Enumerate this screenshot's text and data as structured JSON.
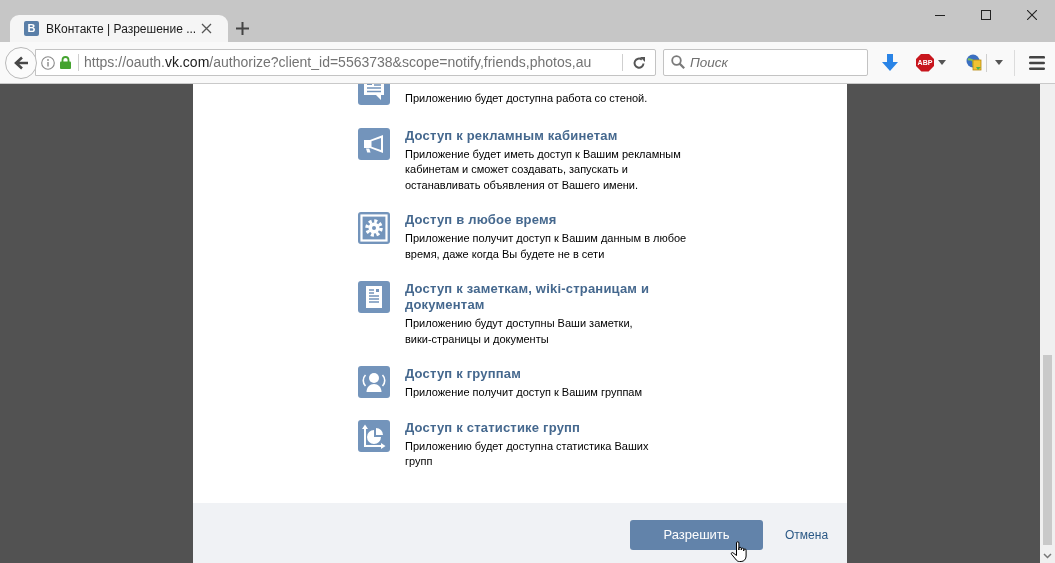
{
  "browser": {
    "tab": {
      "favicon_letter": "В",
      "title": "ВКонтакте | Разрешение ...",
      "selected": true
    },
    "address_bar": {
      "url_start": "https://oauth.",
      "url_domain": "vk.com",
      "url_rest": "/authorize?client_id=5563738&scope=notify,friends,photos,au"
    },
    "search": {
      "placeholder": "Поиск"
    },
    "adblock_label": "ABP"
  },
  "permissions": [
    {
      "kind": "wall",
      "description": "Приложению будет доступна работа со стеной."
    },
    {
      "kind": "ads",
      "title": "Доступ к рекламным кабинетам",
      "description": "Приложение будет иметь доступ к Вашим рекламным\nкабинетам и сможет создавать, запускать и\nостанавливать объявления от Вашего имени."
    },
    {
      "kind": "offline",
      "title": "Доступ в любое время",
      "description": "Приложение получит доступ к Вашим данным в любое\nвремя, даже когда Вы будете не в сети"
    },
    {
      "kind": "docs",
      "title": "Доступ к заметкам, wiki-страницам и\nдокументам",
      "description": "Приложению будут доступны Ваши заметки,\nвики-страницы и документы"
    },
    {
      "kind": "groups",
      "title": "Доступ к группам",
      "description": "Приложение получит доступ к Вашим группам"
    },
    {
      "kind": "stats",
      "title": "Доступ к статистике групп",
      "description": "Приложению будет доступна статистика Ваших\nгрупп"
    }
  ],
  "actions": {
    "allow_button": "Разрешить",
    "cancel_link": "Отмена"
  }
}
